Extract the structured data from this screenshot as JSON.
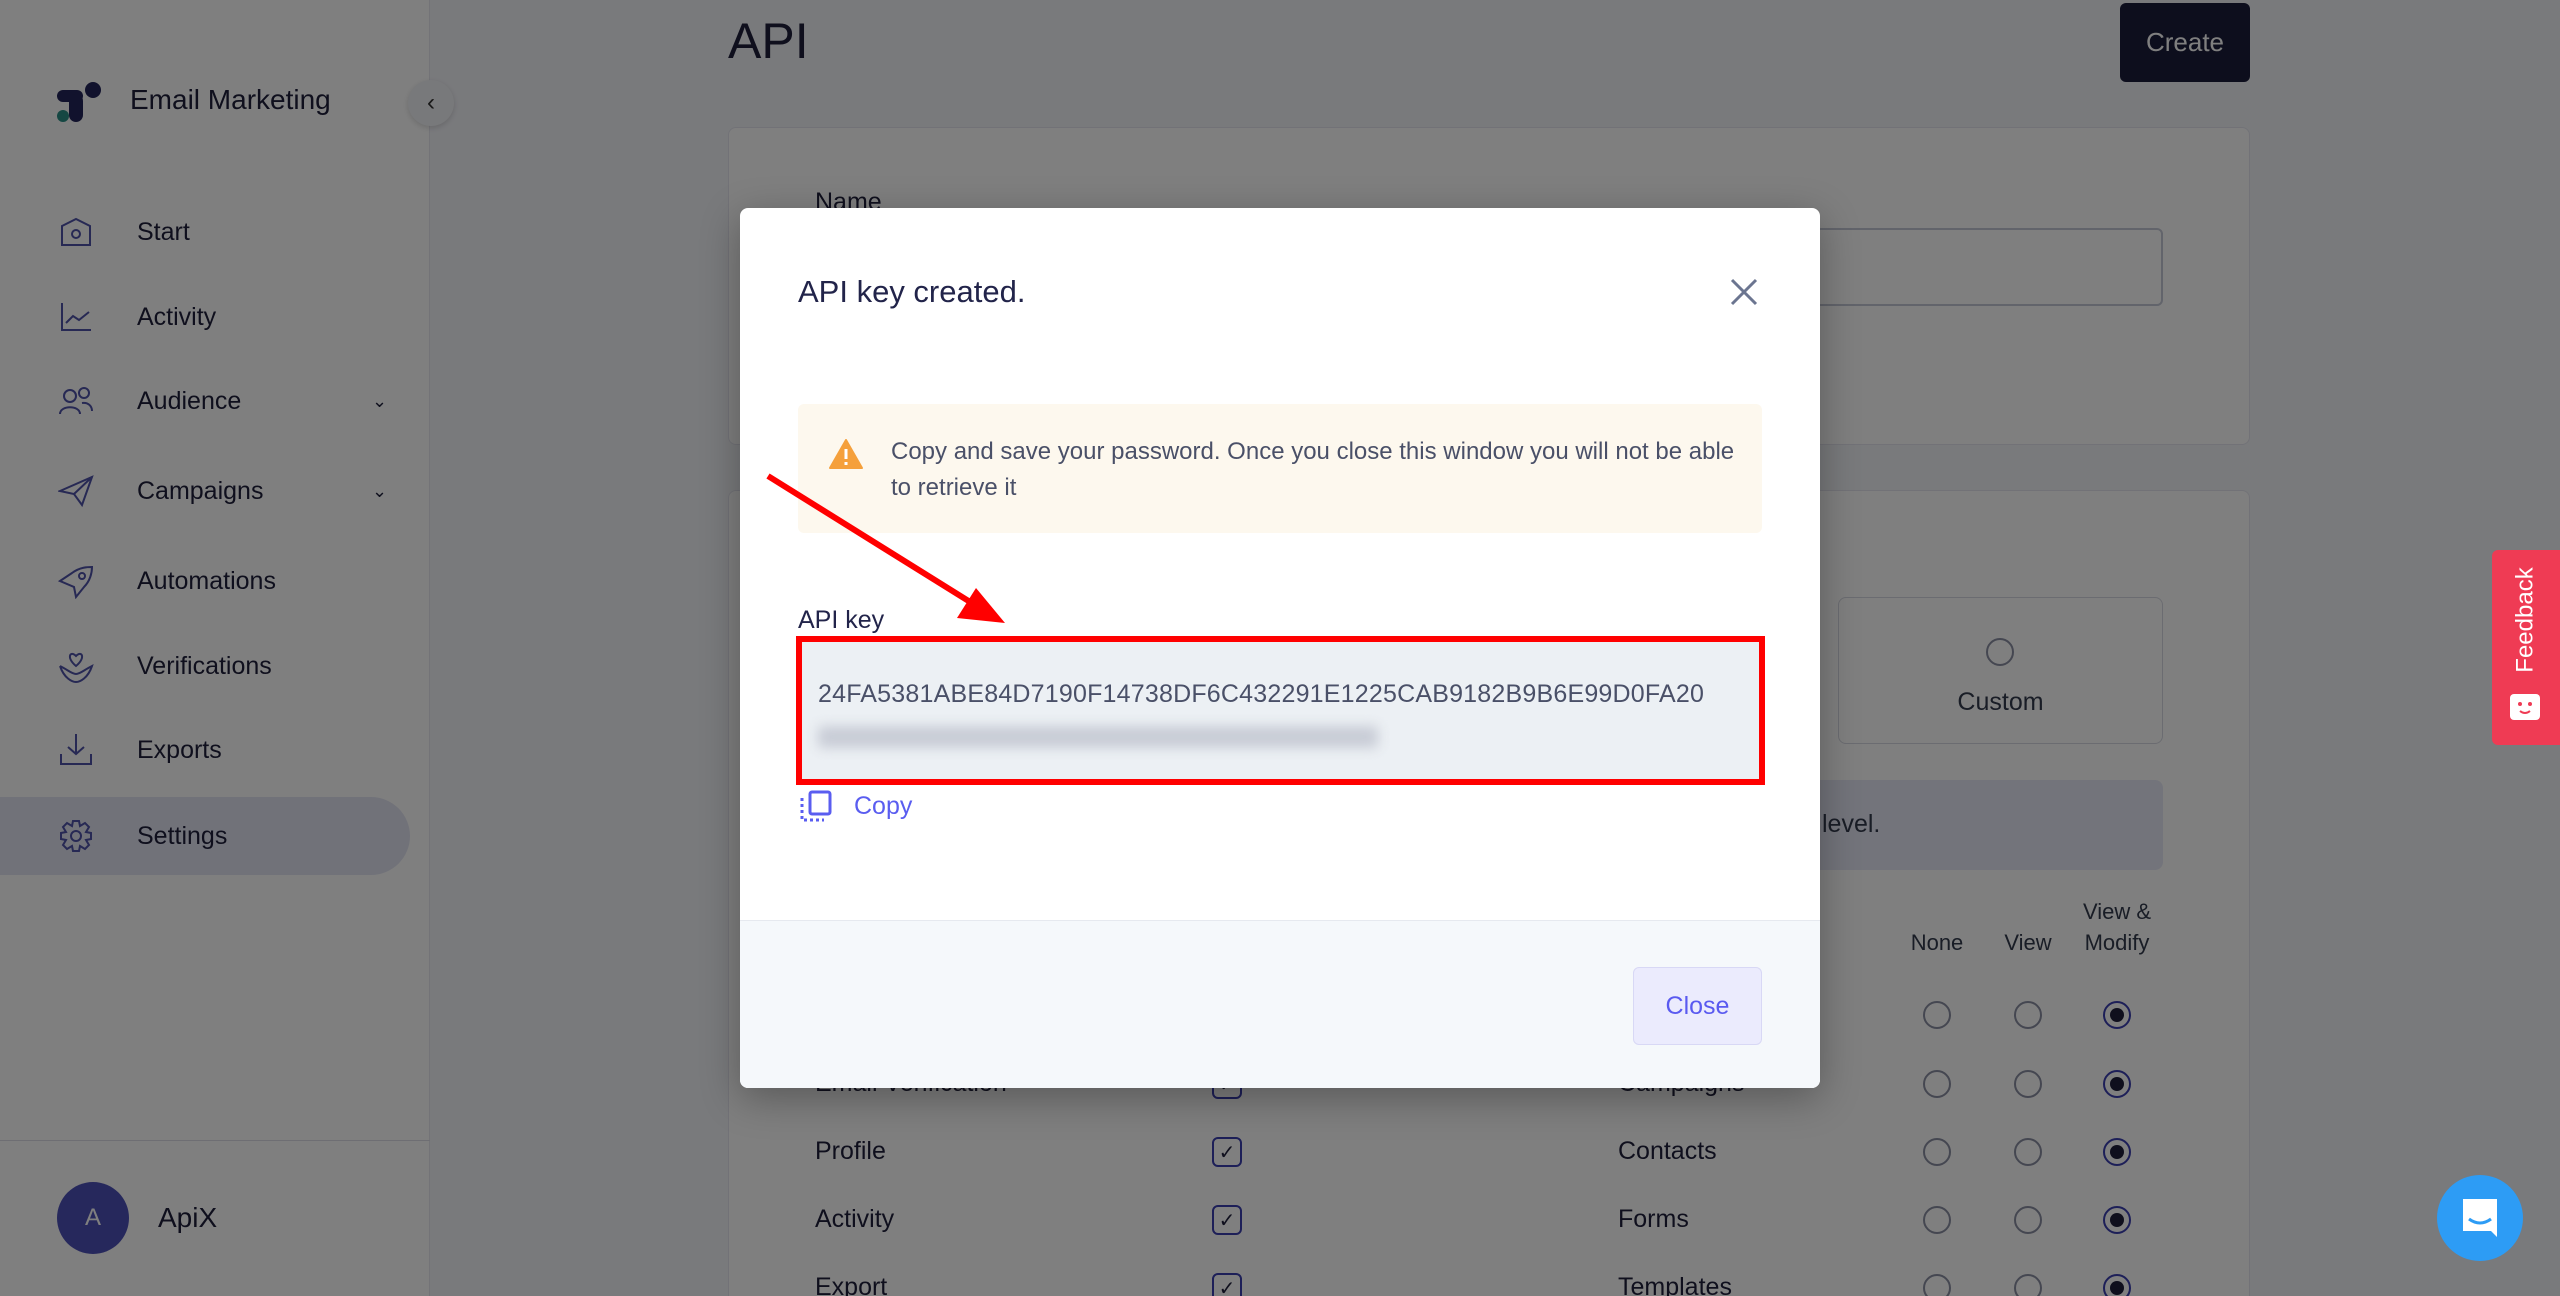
{
  "sidebar": {
    "brand": "Email Marketing",
    "items": [
      {
        "label": "Start",
        "icon": "home-icon"
      },
      {
        "label": "Activity",
        "icon": "chart-icon"
      },
      {
        "label": "Audience",
        "icon": "users-icon",
        "expandable": true
      },
      {
        "label": "Campaigns",
        "icon": "send-icon",
        "expandable": true
      },
      {
        "label": "Automations",
        "icon": "rocket-icon"
      },
      {
        "label": "Verifications",
        "icon": "heart-hand-icon"
      },
      {
        "label": "Exports",
        "icon": "download-icon"
      },
      {
        "label": "Settings",
        "icon": "gear-icon",
        "active": true
      }
    ],
    "user": {
      "initial": "A",
      "name": "ApiX"
    }
  },
  "main": {
    "title": "API",
    "create_label": "Create",
    "name_label": "Name",
    "custom_label": "Custom",
    "info_text": "level.",
    "columns": [
      "None",
      "View",
      "View & Modify"
    ],
    "left_rows": [
      {
        "label": "Email Verification",
        "checked": true
      },
      {
        "label": "Profile",
        "checked": true
      },
      {
        "label": "Activity",
        "checked": true
      },
      {
        "label": "Export",
        "checked": true
      }
    ],
    "right_rows": [
      {
        "label": "",
        "value": "View & Modify"
      },
      {
        "label": "Campaigns",
        "value": "View & Modify"
      },
      {
        "label": "Contacts",
        "value": "View & Modify"
      },
      {
        "label": "Forms",
        "value": "View & Modify"
      },
      {
        "label": "Templates",
        "value": "View & Modify"
      }
    ]
  },
  "modal": {
    "title": "API key created.",
    "warning": "Copy and save your password. Once you close this window you will not be able to retrieve it",
    "key_label": "API key",
    "key_value": "24FA5381ABE84D7190F14738DF6C432291E1225CAB9182B9B6E99D0FA20",
    "copy_label": "Copy",
    "close_label": "Close"
  },
  "widgets": {
    "feedback_label": "Feedback"
  },
  "colors": {
    "accent": "#5a5df0",
    "annotation": "#ff0000",
    "feedback": "#ef3b54",
    "chat": "#2d9cf5",
    "warning": "#f5a03b"
  }
}
